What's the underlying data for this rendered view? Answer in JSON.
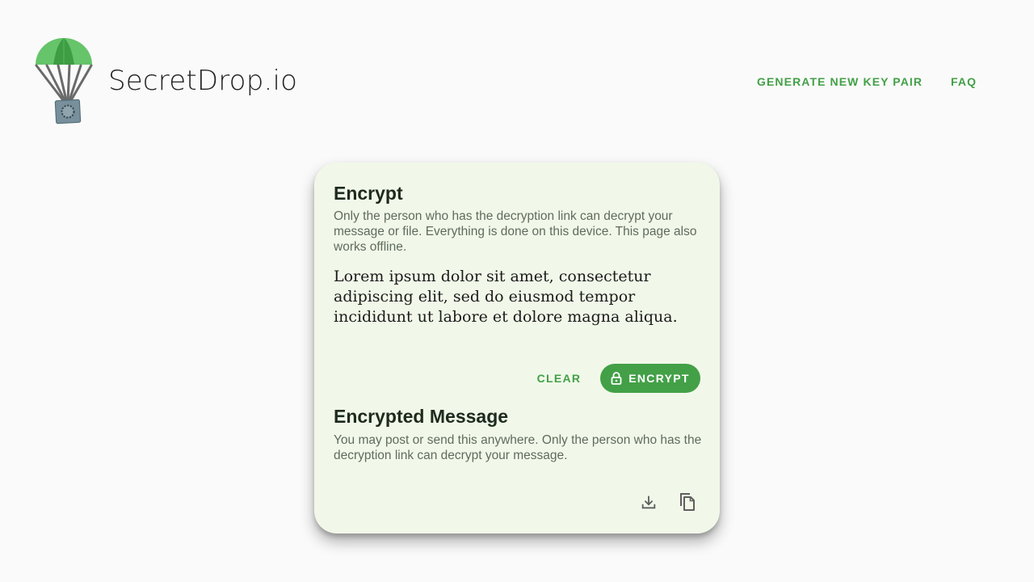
{
  "header": {
    "brand": "SecretDrop.io",
    "logo_icon": "parachute-safe-icon",
    "nav": [
      {
        "label": "GENERATE NEW KEY PAIR"
      },
      {
        "label": "FAQ"
      }
    ]
  },
  "encrypt_card": {
    "title": "Encrypt",
    "description": "Only the person who has the decryption link can decrypt your message or file. Everything is done on this device. This page also works offline.",
    "message": "Lorem ipsum dolor sit amet, consectetur adipiscing elit, sed do eiusmod tempor incididunt ut labore et dolore magna aliqua.",
    "clear_label": "CLEAR",
    "encrypt_label": "ENCRYPT",
    "encrypt_icon": "lock-icon"
  },
  "encrypted_section": {
    "title": "Encrypted Message",
    "description": "You may post or send this anywhere. Only the person who has the decryption link can decrypt your message.",
    "download_icon": "download-icon",
    "copy_icon": "copy-icon"
  },
  "colors": {
    "accent": "#43a047",
    "card_background": "#f1f8e9",
    "page_background": "#fafafa"
  }
}
